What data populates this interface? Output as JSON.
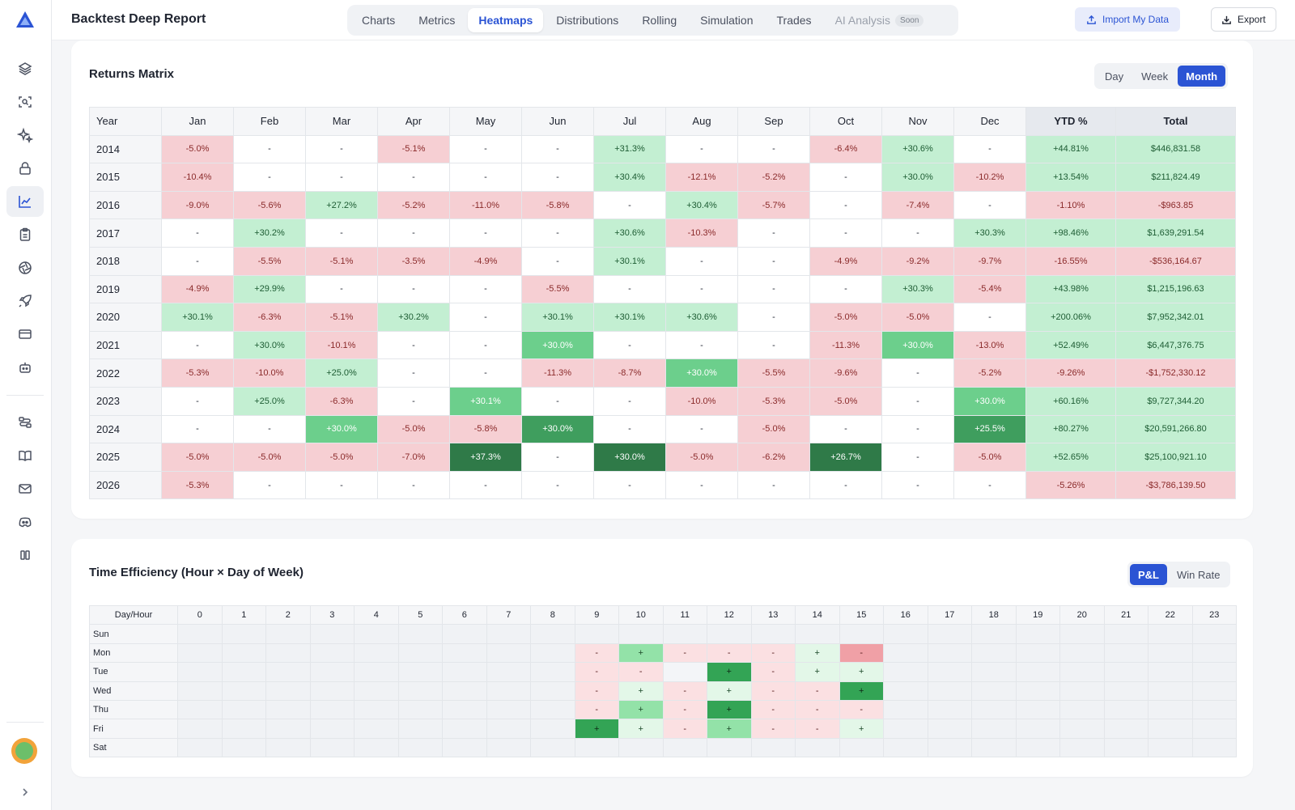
{
  "header": {
    "title": "Backtest Deep Report",
    "tabs": [
      {
        "label": "Charts"
      },
      {
        "label": "Metrics"
      },
      {
        "label": "Heatmaps",
        "active": true
      },
      {
        "label": "Distributions"
      },
      {
        "label": "Rolling"
      },
      {
        "label": "Simulation"
      },
      {
        "label": "Trades"
      },
      {
        "label": "AI Analysis",
        "badge": "Soon"
      }
    ],
    "import_label": "Import My Data",
    "export_label": "Export"
  },
  "colors": {
    "accent": "#2b54d4",
    "loss": "#f6cfd3",
    "gain_light": "#c3efd2",
    "gain_mid": "#6ccf8c",
    "gain_strong": "#3f9e5e",
    "gain_max": "#2f7a48"
  },
  "sidebar": {
    "icons": [
      "layers-icon",
      "scan-search-icon",
      "sparkles-icon",
      "lock-icon",
      "chart-line-icon",
      "clipboard-icon",
      "aperture-icon",
      "rocket-icon",
      "credit-card-icon",
      "bot-icon",
      "workflow-icon",
      "book-icon",
      "mail-icon",
      "discord-icon",
      "columns-icon"
    ],
    "active": "chart-line-icon"
  },
  "returns_matrix": {
    "title": "Returns Matrix",
    "period_options": [
      "Day",
      "Week",
      "Month"
    ],
    "active_period": "Month",
    "columns": [
      "Year",
      "Jan",
      "Feb",
      "Mar",
      "Apr",
      "May",
      "Jun",
      "Jul",
      "Aug",
      "Sep",
      "Oct",
      "Nov",
      "Dec",
      "YTD %",
      "Total"
    ],
    "rows": [
      {
        "year": "2014",
        "months": [
          "-5.0%",
          "-",
          "-",
          "-5.1%",
          "-",
          "-",
          "+31.3%",
          "-",
          "-",
          "-6.4%",
          "+30.6%",
          "-"
        ],
        "ytd": "+44.81%",
        "total": "$446,831.58"
      },
      {
        "year": "2015",
        "months": [
          "-10.4%",
          "-",
          "-",
          "-",
          "-",
          "-",
          "+30.4%",
          "-12.1%",
          "-5.2%",
          "-",
          "+30.0%",
          "-10.2%"
        ],
        "ytd": "+13.54%",
        "total": "$211,824.49"
      },
      {
        "year": "2016",
        "months": [
          "-9.0%",
          "-5.6%",
          "+27.2%",
          "-5.2%",
          "-11.0%",
          "-5.8%",
          "-",
          "+30.4%",
          "-5.7%",
          "-",
          "-7.4%",
          "-"
        ],
        "ytd": "-1.10%",
        "total": "-$963.85"
      },
      {
        "year": "2017",
        "months": [
          "-",
          "+30.2%",
          "-",
          "-",
          "-",
          "-",
          "+30.6%",
          "-10.3%",
          "-",
          "-",
          "-",
          "+30.3%"
        ],
        "ytd": "+98.46%",
        "total": "$1,639,291.54"
      },
      {
        "year": "2018",
        "months": [
          "-",
          "-5.5%",
          "-5.1%",
          "-3.5%",
          "-4.9%",
          "-",
          "+30.1%",
          "-",
          "-",
          "-4.9%",
          "-9.2%",
          "-9.7%"
        ],
        "ytd": "-16.55%",
        "total": "-$536,164.67"
      },
      {
        "year": "2019",
        "months": [
          "-4.9%",
          "+29.9%",
          "-",
          "-",
          "-",
          "-5.5%",
          "-",
          "-",
          "-",
          "-",
          "+30.3%",
          "-5.4%"
        ],
        "ytd": "+43.98%",
        "total": "$1,215,196.63"
      },
      {
        "year": "2020",
        "months": [
          "+30.1%",
          "-6.3%",
          "-5.1%",
          "+30.2%",
          "-",
          "+30.1%",
          "+30.1%",
          "+30.6%",
          "-",
          "-5.0%",
          "-5.0%",
          "-"
        ],
        "ytd": "+200.06%",
        "total": "$7,952,342.01"
      },
      {
        "year": "2021",
        "months": [
          "-",
          "+30.0%",
          "-10.1%",
          "-",
          "-",
          "+30.0%",
          "-",
          "-",
          "-",
          "-11.3%",
          "+30.0%",
          "-13.0%"
        ],
        "ytd": "+52.49%",
        "total": "$6,447,376.75"
      },
      {
        "year": "2022",
        "months": [
          "-5.3%",
          "-10.0%",
          "+25.0%",
          "-",
          "-",
          "-11.3%",
          "-8.7%",
          "+30.0%",
          "-5.5%",
          "-9.6%",
          "-",
          "-5.2%"
        ],
        "ytd": "-9.26%",
        "total": "-$1,752,330.12"
      },
      {
        "year": "2023",
        "months": [
          "-",
          "+25.0%",
          "-6.3%",
          "-",
          "+30.1%",
          "-",
          "-",
          "-10.0%",
          "-5.3%",
          "-5.0%",
          "-",
          "+30.0%"
        ],
        "ytd": "+60.16%",
        "total": "$9,727,344.20"
      },
      {
        "year": "2024",
        "months": [
          "-",
          "-",
          "+30.0%",
          "-5.0%",
          "-5.8%",
          "+30.0%",
          "-",
          "-",
          "-5.0%",
          "-",
          "-",
          "+25.5%"
        ],
        "ytd": "+80.27%",
        "total": "$20,591,266.80"
      },
      {
        "year": "2025",
        "months": [
          "-5.0%",
          "-5.0%",
          "-5.0%",
          "-7.0%",
          "+37.3%",
          "-",
          "+30.0%",
          "-5.0%",
          "-6.2%",
          "+26.7%",
          "-",
          "-5.0%"
        ],
        "ytd": "+52.65%",
        "total": "$25,100,921.10"
      },
      {
        "year": "2026",
        "months": [
          "-5.3%",
          "-",
          "-",
          "-",
          "-",
          "-",
          "-",
          "-",
          "-",
          "-",
          "-",
          "-"
        ],
        "ytd": "-5.26%",
        "total": "-$3,786,139.50"
      }
    ],
    "intensity": [
      [
        "nl",
        "neu",
        "neu",
        "nl",
        "neu",
        "neu",
        "p1",
        "neu",
        "neu",
        "nl",
        "p1",
        "neu"
      ],
      [
        "nl",
        "neu",
        "neu",
        "neu",
        "neu",
        "neu",
        "p1",
        "nl",
        "nl",
        "neu",
        "p1",
        "nl"
      ],
      [
        "nl",
        "nl",
        "p1",
        "nl",
        "nl",
        "nl",
        "neu",
        "p1",
        "nl",
        "neu",
        "nl",
        "neu"
      ],
      [
        "neu",
        "p1",
        "neu",
        "neu",
        "neu",
        "neu",
        "p1",
        "nl",
        "neu",
        "neu",
        "neu",
        "p1"
      ],
      [
        "neu",
        "nl",
        "nl",
        "nl",
        "nl",
        "neu",
        "p1",
        "neu",
        "neu",
        "nl",
        "nl",
        "nl"
      ],
      [
        "nl",
        "p1",
        "neu",
        "neu",
        "neu",
        "nl",
        "neu",
        "neu",
        "neu",
        "neu",
        "p1",
        "nl"
      ],
      [
        "p1",
        "nl",
        "nl",
        "p1",
        "neu",
        "p1",
        "p1",
        "p1",
        "neu",
        "nl",
        "nl",
        "neu"
      ],
      [
        "neu",
        "p1",
        "nl",
        "neu",
        "neu",
        "p2",
        "neu",
        "neu",
        "neu",
        "nl",
        "p2",
        "nl"
      ],
      [
        "nl",
        "nl",
        "p1",
        "neu",
        "neu",
        "nl",
        "nl",
        "p2",
        "nl",
        "nl",
        "neu",
        "nl"
      ],
      [
        "neu",
        "p1",
        "nl",
        "neu",
        "p2",
        "neu",
        "neu",
        "nl",
        "nl",
        "nl",
        "neu",
        "p2"
      ],
      [
        "neu",
        "neu",
        "p2",
        "nl",
        "nl",
        "p3",
        "neu",
        "neu",
        "nl",
        "neu",
        "neu",
        "p3"
      ],
      [
        "nl",
        "nl",
        "nl",
        "nl",
        "p4",
        "neu",
        "p4",
        "nl",
        "nl",
        "p4",
        "neu",
        "nl"
      ],
      [
        "nl",
        "neu",
        "neu",
        "neu",
        "neu",
        "neu",
        "neu",
        "neu",
        "neu",
        "neu",
        "neu",
        "neu"
      ]
    ]
  },
  "time_efficiency": {
    "title": "Time Efficiency (Hour × Day of Week)",
    "metric_options": [
      "P&L",
      "Win Rate"
    ],
    "active_metric": "P&L",
    "corner_label": "Day/Hour",
    "hours": [
      "0",
      "1",
      "2",
      "3",
      "4",
      "5",
      "6",
      "7",
      "8",
      "9",
      "10",
      "11",
      "12",
      "13",
      "14",
      "15",
      "16",
      "17",
      "18",
      "19",
      "20",
      "21",
      "22",
      "23"
    ],
    "days": [
      "Sun",
      "Mon",
      "Tue",
      "Wed",
      "Thu",
      "Fri",
      "Sat"
    ],
    "cells": {
      "Mon": {
        "9": [
          "-",
          "lr"
        ],
        "10": [
          "+",
          "mg"
        ],
        "11": [
          "-",
          "lr"
        ],
        "12": [
          "-",
          "lr"
        ],
        "13": [
          "-",
          "lr"
        ],
        "14": [
          "+",
          "lg"
        ],
        "15": [
          "-",
          "mr"
        ]
      },
      "Tue": {
        "9": [
          "-",
          "lr"
        ],
        "10": [
          "-",
          "lr"
        ],
        "11": [
          "",
          "w"
        ],
        "12": [
          "+",
          "dg"
        ],
        "13": [
          "-",
          "lr"
        ],
        "14": [
          "+",
          "lg"
        ],
        "15": [
          "+",
          "lg"
        ]
      },
      "Wed": {
        "9": [
          "-",
          "lr"
        ],
        "10": [
          "+",
          "lg"
        ],
        "11": [
          "-",
          "lr"
        ],
        "12": [
          "+",
          "lg"
        ],
        "13": [
          "-",
          "lr"
        ],
        "14": [
          "-",
          "lr"
        ],
        "15": [
          "+",
          "dg"
        ]
      },
      "Thu": {
        "9": [
          "-",
          "lr"
        ],
        "10": [
          "+",
          "mg"
        ],
        "11": [
          "-",
          "lr"
        ],
        "12": [
          "+",
          "dg"
        ],
        "13": [
          "-",
          "lr"
        ],
        "14": [
          "-",
          "lr"
        ],
        "15": [
          "-",
          "lr"
        ]
      },
      "Fri": {
        "9": [
          "+",
          "dg"
        ],
        "10": [
          "+",
          "lg"
        ],
        "11": [
          "-",
          "lr"
        ],
        "12": [
          "+",
          "mg"
        ],
        "13": [
          "-",
          "lr"
        ],
        "14": [
          "-",
          "lr"
        ],
        "15": [
          "+",
          "lg"
        ]
      }
    }
  }
}
